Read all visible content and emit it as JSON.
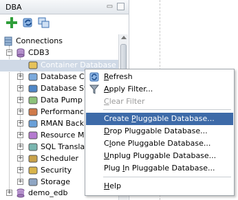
{
  "panel": {
    "title": "DBA",
    "minimize_glyph": "▭",
    "close_glyph": "✕"
  },
  "toolbar": {
    "icons": [
      "add-connection-icon",
      "refresh-icon",
      "copy-icon"
    ]
  },
  "tree": {
    "connections_label": "Connections",
    "cdb_label": "CDB3",
    "nodes": [
      {
        "label": "Container Database",
        "icon": "database-folder-icon",
        "expander": false
      },
      {
        "label": "Database C",
        "icon": "database-config-icon",
        "expander": true
      },
      {
        "label": "Database St",
        "icon": "database-status-icon",
        "expander": true
      },
      {
        "label": "Data Pump",
        "icon": "data-pump-icon",
        "expander": true
      },
      {
        "label": "Performanc",
        "icon": "performance-icon",
        "expander": true
      },
      {
        "label": "RMAN Back",
        "icon": "rman-backup-icon",
        "expander": true
      },
      {
        "label": "Resource M",
        "icon": "resource-manager-icon",
        "expander": true
      },
      {
        "label": "SQL Transla",
        "icon": "sql-translator-icon",
        "expander": true
      },
      {
        "label": "Scheduler",
        "icon": "scheduler-icon",
        "expander": true
      },
      {
        "label": "Security",
        "icon": "security-icon",
        "expander": true
      },
      {
        "label": "Storage",
        "icon": "storage-icon",
        "expander": true
      }
    ],
    "demo_label": "demo_edb"
  },
  "context_menu": {
    "items": [
      {
        "pre": "",
        "u": "R",
        "post": "efresh",
        "icon": "refresh-icon",
        "state": "normal"
      },
      {
        "pre": "",
        "u": "A",
        "post": "pply Filter...",
        "icon": "filter-icon",
        "state": "normal"
      },
      {
        "pre": "",
        "u": "C",
        "post": "lear Filter",
        "icon": "",
        "state": "disabled"
      },
      {
        "pre": "Create ",
        "u": "P",
        "post": "luggable Database...",
        "icon": "",
        "state": "highlighted"
      },
      {
        "pre": "",
        "u": "D",
        "post": "rop Pluggable Database...",
        "icon": "",
        "state": "normal"
      },
      {
        "pre": "C",
        "u": "l",
        "post": "one Pluggable Database...",
        "icon": "",
        "state": "normal"
      },
      {
        "pre": "",
        "u": "U",
        "post": "nplug Pluggable Database...",
        "icon": "",
        "state": "normal"
      },
      {
        "pre": "Plug ",
        "u": "I",
        "post": "n Pluggable Database...",
        "icon": "",
        "state": "normal"
      },
      {
        "pre": "",
        "u": "H",
        "post": "elp",
        "icon": "",
        "state": "normal"
      }
    ]
  },
  "colors": {
    "highlight": "#3d6aa8",
    "selection": "#cfd9e6",
    "disabled_text": "#9a9a9a"
  }
}
